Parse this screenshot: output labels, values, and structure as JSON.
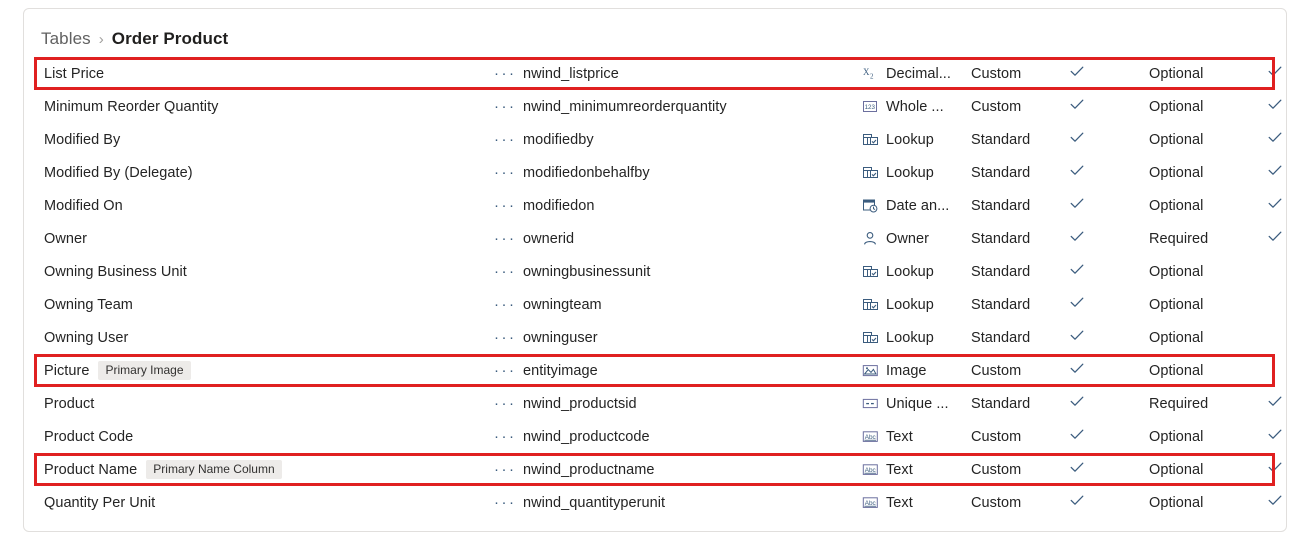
{
  "breadcrumb": {
    "parent": "Tables",
    "separator": "›",
    "current": "Order Product"
  },
  "colors": {
    "highlight": "#e02020",
    "panel_border": "#e1dfdd",
    "text": "#242424",
    "muted_text": "#616161",
    "badge_bg": "#edebe9",
    "dots": "#3b5c7e",
    "check": "#3b5c7e"
  },
  "grid": {
    "row_menu_glyph": "···",
    "rows": [
      {
        "display_name": "List Price",
        "badge": "",
        "logical_name": "nwind_listprice",
        "data_type": "Decimal...",
        "type_icon": "decimal-number-icon",
        "customization": "Custom",
        "customization_check": true,
        "requirement": "Optional",
        "requirement_check": true,
        "highlighted": true
      },
      {
        "display_name": "Minimum Reorder Quantity",
        "badge": "",
        "logical_name": "nwind_minimumreorderquantity",
        "data_type": "Whole ...",
        "type_icon": "whole-number-icon",
        "customization": "Custom",
        "customization_check": true,
        "requirement": "Optional",
        "requirement_check": true,
        "highlighted": false
      },
      {
        "display_name": "Modified By",
        "badge": "",
        "logical_name": "modifiedby",
        "data_type": "Lookup",
        "type_icon": "lookup-icon",
        "customization": "Standard",
        "customization_check": true,
        "requirement": "Optional",
        "requirement_check": true,
        "highlighted": false
      },
      {
        "display_name": "Modified By (Delegate)",
        "badge": "",
        "logical_name": "modifiedonbehalfby",
        "data_type": "Lookup",
        "type_icon": "lookup-icon",
        "customization": "Standard",
        "customization_check": true,
        "requirement": "Optional",
        "requirement_check": true,
        "highlighted": false
      },
      {
        "display_name": "Modified On",
        "badge": "",
        "logical_name": "modifiedon",
        "data_type": "Date an...",
        "type_icon": "date-and-time-icon",
        "customization": "Standard",
        "customization_check": true,
        "requirement": "Optional",
        "requirement_check": true,
        "highlighted": false
      },
      {
        "display_name": "Owner",
        "badge": "",
        "logical_name": "ownerid",
        "data_type": "Owner",
        "type_icon": "owner-person-icon",
        "customization": "Standard",
        "customization_check": true,
        "requirement": "Required",
        "requirement_check": true,
        "highlighted": false
      },
      {
        "display_name": "Owning Business Unit",
        "badge": "",
        "logical_name": "owningbusinessunit",
        "data_type": "Lookup",
        "type_icon": "lookup-icon",
        "customization": "Standard",
        "customization_check": true,
        "requirement": "Optional",
        "requirement_check": false,
        "highlighted": false
      },
      {
        "display_name": "Owning Team",
        "badge": "",
        "logical_name": "owningteam",
        "data_type": "Lookup",
        "type_icon": "lookup-icon",
        "customization": "Standard",
        "customization_check": true,
        "requirement": "Optional",
        "requirement_check": false,
        "highlighted": false
      },
      {
        "display_name": "Owning User",
        "badge": "",
        "logical_name": "owninguser",
        "data_type": "Lookup",
        "type_icon": "lookup-icon",
        "customization": "Standard",
        "customization_check": true,
        "requirement": "Optional",
        "requirement_check": false,
        "highlighted": false
      },
      {
        "display_name": "Picture",
        "badge": "Primary Image",
        "logical_name": "entityimage",
        "data_type": "Image",
        "type_icon": "image-icon",
        "customization": "Custom",
        "customization_check": true,
        "requirement": "Optional",
        "requirement_check": false,
        "highlighted": true
      },
      {
        "display_name": "Product",
        "badge": "",
        "logical_name": "nwind_productsid",
        "data_type": "Unique ...",
        "type_icon": "unique-identifier-icon",
        "customization": "Standard",
        "customization_check": true,
        "requirement": "Required",
        "requirement_check": true,
        "highlighted": false
      },
      {
        "display_name": "Product Code",
        "badge": "",
        "logical_name": "nwind_productcode",
        "data_type": "Text",
        "type_icon": "text-icon",
        "customization": "Custom",
        "customization_check": true,
        "requirement": "Optional",
        "requirement_check": true,
        "highlighted": false
      },
      {
        "display_name": "Product Name",
        "badge": "Primary Name Column",
        "logical_name": "nwind_productname",
        "data_type": "Text",
        "type_icon": "text-icon",
        "customization": "Custom",
        "customization_check": true,
        "requirement": "Optional",
        "requirement_check": true,
        "highlighted": true
      },
      {
        "display_name": "Quantity Per Unit",
        "badge": "",
        "logical_name": "nwind_quantityperunit",
        "data_type": "Text",
        "type_icon": "text-icon",
        "customization": "Custom",
        "customization_check": true,
        "requirement": "Optional",
        "requirement_check": true,
        "highlighted": false
      }
    ]
  }
}
